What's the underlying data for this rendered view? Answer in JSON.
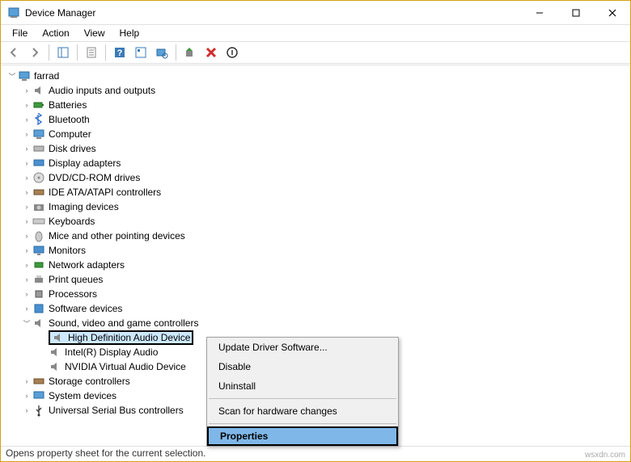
{
  "window": {
    "title": "Device Manager"
  },
  "menu": {
    "file": "File",
    "action": "Action",
    "view": "View",
    "help": "Help"
  },
  "tree": {
    "root": "farrad",
    "nodes": {
      "audio_io": "Audio inputs and outputs",
      "batteries": "Batteries",
      "bluetooth": "Bluetooth",
      "computer": "Computer",
      "disk": "Disk drives",
      "display": "Display adapters",
      "dvd": "DVD/CD-ROM drives",
      "ide": "IDE ATA/ATAPI controllers",
      "imaging": "Imaging devices",
      "keyboards": "Keyboards",
      "mice": "Mice and other pointing devices",
      "monitors": "Monitors",
      "network": "Network adapters",
      "printq": "Print queues",
      "proc": "Processors",
      "softdev": "Software devices",
      "sound": "Sound, video and game controllers",
      "storage": "Storage controllers",
      "sysdev": "System devices",
      "usb": "Universal Serial Bus controllers"
    },
    "sound_children": {
      "hda": "High Definition Audio Device",
      "intel": "Intel(R) Display Audio",
      "nvidia": "NVIDIA Virtual Audio Device"
    }
  },
  "context_menu": {
    "update": "Update Driver Software...",
    "disable": "Disable",
    "uninstall": "Uninstall",
    "scan": "Scan for hardware changes",
    "properties": "Properties"
  },
  "statusbar": {
    "text": "Opens property sheet for the current selection."
  },
  "watermark": "wsxdn.com"
}
